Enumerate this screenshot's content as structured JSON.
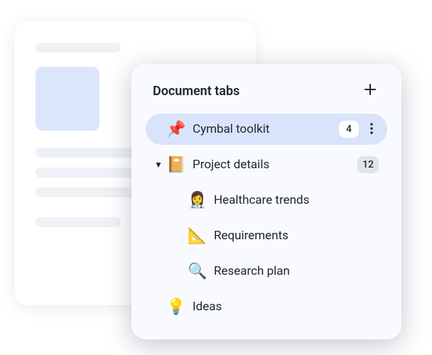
{
  "panel": {
    "title": "Document tabs"
  },
  "tabs": [
    {
      "icon": "📌",
      "label": "Cymbal toolkit",
      "count": "4",
      "selected": true,
      "has_menu": true
    },
    {
      "icon": "📔",
      "label": "Project details",
      "count": "12",
      "expanded": true
    },
    {
      "icon": "👩‍⚕️",
      "label": "Healthcare trends",
      "nested": true
    },
    {
      "icon": "📐",
      "label": "Requirements",
      "nested": true
    },
    {
      "icon": "🔍",
      "label": "Research plan",
      "nested": true
    },
    {
      "icon": "💡",
      "label": "Ideas"
    }
  ]
}
